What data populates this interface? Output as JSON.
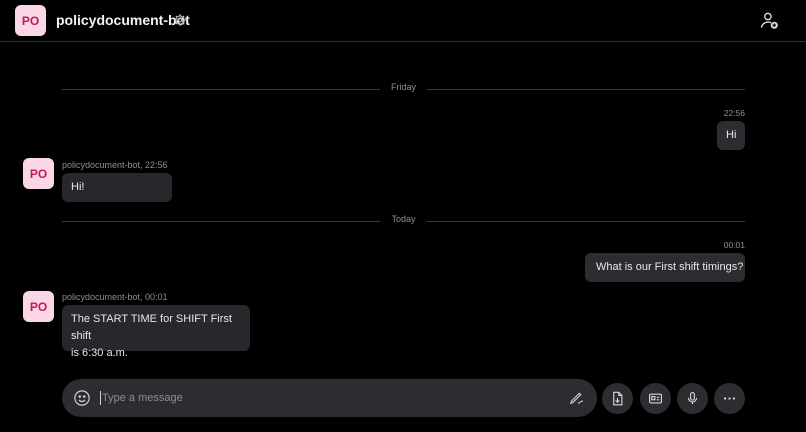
{
  "header": {
    "avatar_initials": "PO",
    "title": "policydocument-bot",
    "settings_icon": "gear-icon",
    "add_user_icon": "add-user-icon"
  },
  "conversation": {
    "dividers": [
      {
        "label": "Friday"
      },
      {
        "label": "Today"
      }
    ],
    "messages": [
      {
        "direction": "outgoing",
        "time": "22:56",
        "text": "Hi"
      },
      {
        "direction": "incoming",
        "avatar_initials": "PO",
        "meta": "policydocument-bot, 22:56",
        "text": "Hi!"
      },
      {
        "direction": "outgoing",
        "time": "00:01",
        "text": "What is our First shift timings?"
      },
      {
        "direction": "incoming",
        "avatar_initials": "PO",
        "meta": "policydocument-bot, 00:01",
        "text_lines": [
          "The START TIME for SHIFT First shift",
          "is 6:30 a.m."
        ]
      }
    ]
  },
  "composer": {
    "placeholder": "Type a message",
    "value": "",
    "emoji_icon": "emoji-icon",
    "pen_icon": "pen-icon",
    "buttons": [
      "attach-file-icon",
      "card-icon",
      "microphone-icon",
      "more-icon"
    ]
  },
  "colors": {
    "background": "#000000",
    "bubble": "#2b2d31",
    "avatar_bg": "#f9d7e7",
    "avatar_text": "#c2185b",
    "muted_text": "#8e8e8e"
  }
}
